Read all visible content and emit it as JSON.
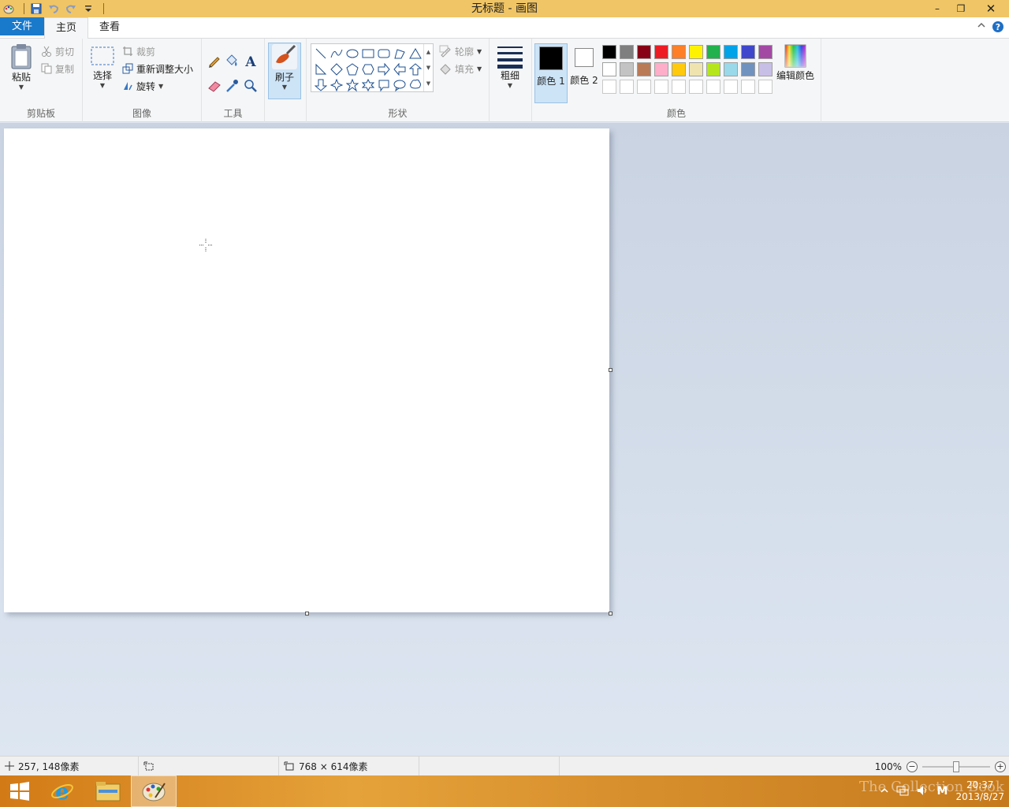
{
  "window": {
    "title": "无标题 - 画图",
    "minimize": "–",
    "restore": "❐",
    "close": "✕"
  },
  "tabs": {
    "file": "文件",
    "home": "主页",
    "view": "查看"
  },
  "clipboard": {
    "group": "剪贴板",
    "paste": "粘贴",
    "cut": "剪切",
    "copy": "复制"
  },
  "image": {
    "group": "图像",
    "select": "选择",
    "crop": "裁剪",
    "resize": "重新调整大小",
    "rotate": "旋转"
  },
  "tools": {
    "group": "工具"
  },
  "brushes": {
    "label": "刷子"
  },
  "shapes": {
    "group": "形状",
    "outline": "轮廓",
    "fill": "填充"
  },
  "size": {
    "label": "粗细"
  },
  "colors": {
    "group": "颜色",
    "color1": "颜色 1",
    "color2": "颜色 2",
    "edit": "编辑颜色",
    "color1_value": "#000000",
    "color2_value": "#ffffff",
    "palette": [
      "#000000",
      "#7f7f7f",
      "#880015",
      "#ed1c24",
      "#ff7f27",
      "#fff200",
      "#22b14c",
      "#00a2e8",
      "#3f48cc",
      "#a349a4",
      "#ffffff",
      "#c3c3c3",
      "#b97a57",
      "#ffaec9",
      "#ffc90e",
      "#efe4b0",
      "#b5e61d",
      "#99d9ea",
      "#7092be",
      "#c8bfe7",
      "#ffffff",
      "#ffffff",
      "#ffffff",
      "#ffffff",
      "#ffffff",
      "#ffffff",
      "#ffffff",
      "#ffffff",
      "#ffffff",
      "#ffffff"
    ]
  },
  "status": {
    "cursor_pos": "257, 148像素",
    "selection": "",
    "canvas_size": "768 × 614像素",
    "zoom": "100%",
    "zoom_fraction": 0.5
  },
  "taskbar": {
    "time": "20:37",
    "date": "2013/8/27",
    "ime": "M"
  },
  "watermark": "The Collection Book"
}
